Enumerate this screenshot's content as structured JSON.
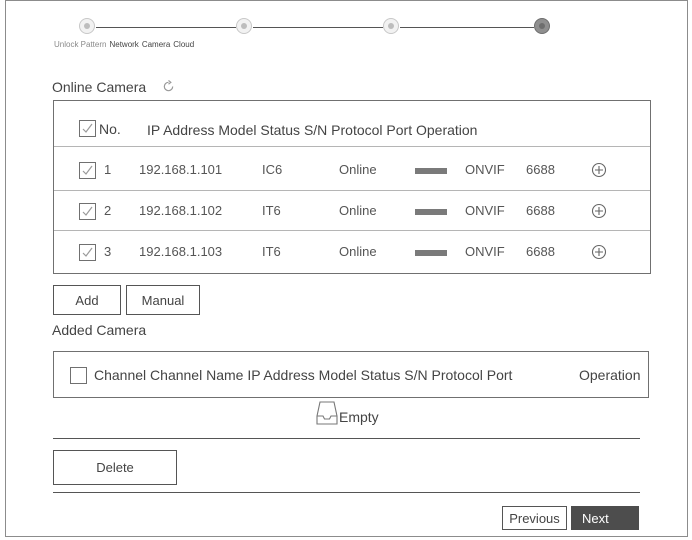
{
  "wizard": {
    "steps": [
      "Unlock Pattern",
      "Network",
      "Camera",
      "Cloud"
    ],
    "current_step": 3
  },
  "online": {
    "title": "Online Camera",
    "columns": {
      "no": "No.",
      "rest": "IP Address Model Status S/N Protocol Port Operation"
    },
    "rows": [
      {
        "no": "1",
        "ip": "192.168.1.101",
        "model": "IC6",
        "status": "Online",
        "protocol": "ONVIF",
        "port": "6688",
        "checked": true
      },
      {
        "no": "2",
        "ip": "192.168.1.102",
        "model": "IT6",
        "status": "Online",
        "protocol": "ONVIF",
        "port": "6688",
        "checked": true
      },
      {
        "no": "3",
        "ip": "192.168.1.103",
        "model": "IT6",
        "status": "Online",
        "protocol": "ONVIF",
        "port": "6688",
        "checked": true
      }
    ],
    "add_label": "Add",
    "manual_label": "Manual"
  },
  "added": {
    "title": "Added Camera",
    "columns": {
      "main": "Channel Channel Name  IP Address Model Status S/N Protocol Port",
      "operation": "Operation"
    },
    "empty_label": "Empty",
    "delete_label": "Delete"
  },
  "footer": {
    "previous_label": "Previous",
    "next_label": "Next"
  },
  "colors": {
    "border": "#707070",
    "dark_button": "#4d4d4d",
    "text": "#444444"
  }
}
